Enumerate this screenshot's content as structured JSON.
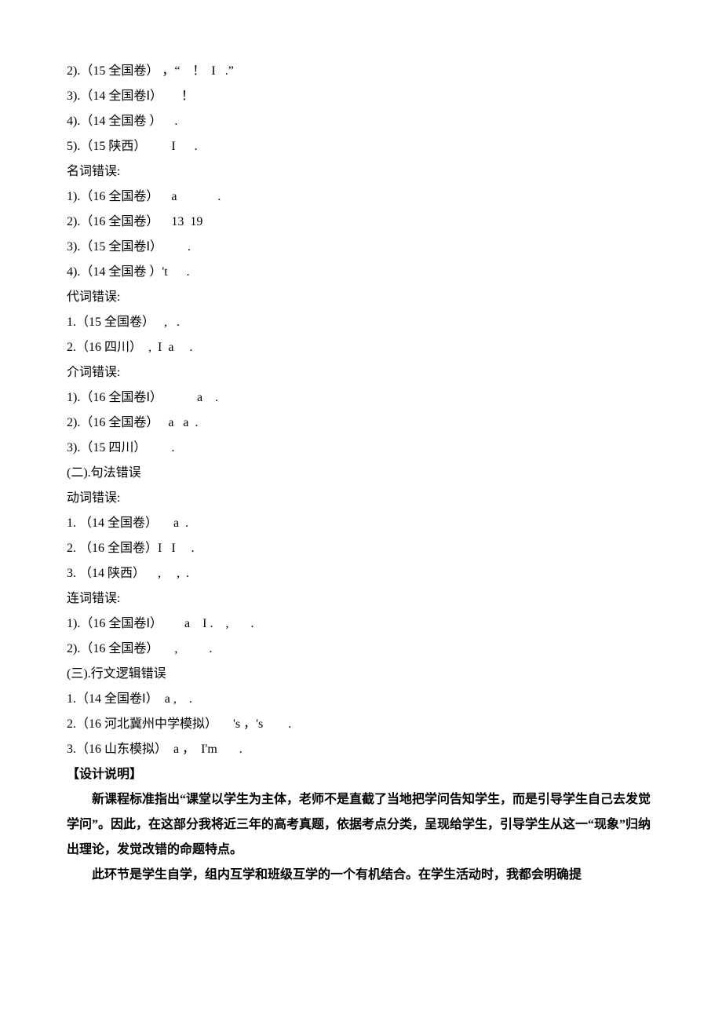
{
  "lines": [
    "2).（15 全国卷） ，“    ！  I   .”",
    "3).（14 全国卷Ⅰ）      ！",
    "4).（14 全国卷 ）    .",
    "5).（15 陕西）        I      .",
    "名词错误:",
    "1).（16 全国卷）    a             .",
    "2).（16 全国卷）    13  19",
    "3).（15 全国卷Ⅰ）        .",
    "4).（14 全国卷 ）'t      .",
    "代词错误:",
    "1.（15 全国卷）   ,   .",
    "2.（16 四川）  ,  I  a     .",
    "介词错误:",
    "1).（16 全国卷Ⅰ）           a    .",
    "2).（16 全国卷）   a   a  .",
    "3).（15 四川）        .",
    "(二).句法错误",
    "动词错误:",
    "1. （14 全国卷）     a  .",
    "2. （16 全国卷）I   I     .",
    "3. （14 陕西）    ,     ,  .",
    "连词错误:",
    "1).（16 全国卷Ⅰ）       a    I .    ,       .",
    "2).（16 全国卷）     ,          .",
    "(三).行文逻辑错误",
    "1.（14 全国卷Ⅰ）  a ,    .",
    "2.（16 河北冀州中学模拟）     's ，'s        .",
    "3.（16 山东模拟）  a ，  I'm       ."
  ],
  "design_heading": "【设计说明】",
  "design_p1": "新课程标准指出“课堂以学生为主体，老师不是直截了当地把学问告知学生，而是引导学生自己去发觉学问”。因此，在这部分我将近三年的高考真题，依据考点分类，呈现给学生，引导学生从这一“现象”归纳出理论，发觉改错的命题特点。",
  "design_p2": "此环节是学生自学，组内互学和班级互学的一个有机结合。在学生活动时，我都会明确提"
}
